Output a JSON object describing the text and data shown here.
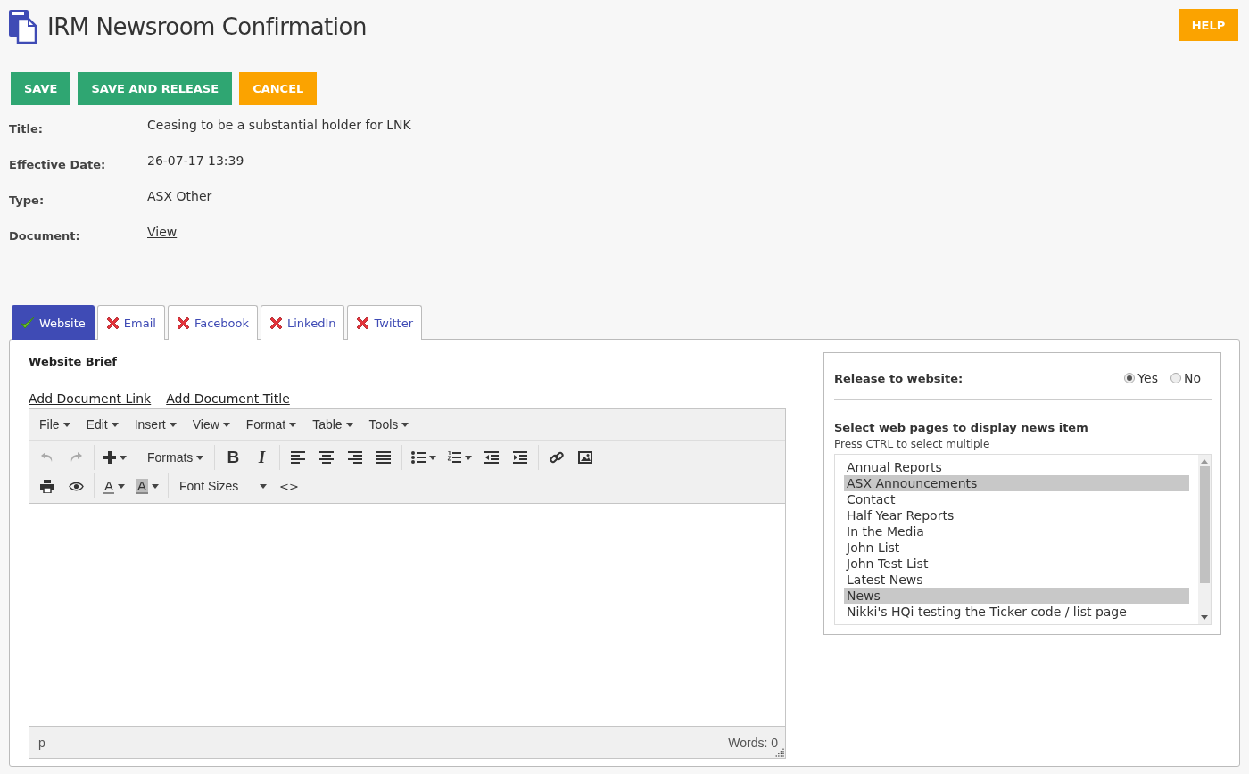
{
  "header": {
    "title": "IRM Newsroom Confirmation",
    "help": "HELP"
  },
  "actions": [
    {
      "label": "SAVE",
      "kind": "primary"
    },
    {
      "label": "SAVE AND RELEASE",
      "kind": "primary"
    },
    {
      "label": "CANCEL",
      "kind": "warning"
    }
  ],
  "details": [
    {
      "label": "Title:",
      "value": "Ceasing to be a substantial holder for LNK",
      "kind": "text"
    },
    {
      "label": "Effective Date:",
      "value": "26-07-17 13:39",
      "kind": "text"
    },
    {
      "label": "Type:",
      "value": "ASX Other",
      "kind": "text"
    },
    {
      "label": "Document:",
      "value": "View",
      "kind": "link"
    }
  ],
  "tabs": [
    {
      "label": "Website",
      "kind": "check",
      "selected": true
    },
    {
      "label": "Email",
      "kind": "cross",
      "selected": false
    },
    {
      "label": "Facebook",
      "kind": "cross",
      "selected": false
    },
    {
      "label": "LinkedIn",
      "kind": "cross",
      "selected": false
    },
    {
      "label": "Twitter",
      "kind": "cross",
      "selected": false
    }
  ],
  "brief": {
    "heading": "Website Brief",
    "links": [
      "Add Document Link",
      "Add Document Title"
    ]
  },
  "editor": {
    "menus": [
      "File",
      "Edit",
      "Insert",
      "View",
      "Format",
      "Table",
      "Tools"
    ],
    "toolbar_rows": [
      [
        {
          "kind": "undo",
          "disabled": true
        },
        {
          "kind": "redo",
          "disabled": true
        },
        {
          "kind": "sep"
        },
        {
          "kind": "plus",
          "disabled": false
        },
        {
          "kind": "sep"
        },
        {
          "kind": "select",
          "label": "Formats",
          "disabled": false
        },
        {
          "kind": "sep"
        },
        {
          "kind": "bold",
          "label": "B",
          "disabled": false
        },
        {
          "kind": "italic",
          "label": "I",
          "disabled": false
        },
        {
          "kind": "sep"
        },
        {
          "kind": "align-left",
          "disabled": false
        },
        {
          "kind": "align-center",
          "disabled": false
        },
        {
          "kind": "align-right",
          "disabled": false
        },
        {
          "kind": "align-justify",
          "disabled": false
        },
        {
          "kind": "sep"
        },
        {
          "kind": "bullets",
          "disabled": false
        },
        {
          "kind": "numbers",
          "disabled": false
        },
        {
          "kind": "outdent",
          "disabled": false
        },
        {
          "kind": "indent",
          "disabled": false
        },
        {
          "kind": "sep"
        },
        {
          "kind": "link",
          "disabled": false
        },
        {
          "kind": "image",
          "disabled": false
        }
      ],
      [
        {
          "kind": "print",
          "disabled": false
        },
        {
          "kind": "preview",
          "disabled": false
        },
        {
          "kind": "sep"
        },
        {
          "kind": "forecolor",
          "label": "A",
          "disabled": false
        },
        {
          "kind": "backcolor",
          "label": "A",
          "disabled": false
        },
        {
          "kind": "sep"
        },
        {
          "kind": "select-wide",
          "label": "Font Sizes",
          "disabled": false
        },
        {
          "kind": "code",
          "label": "<>",
          "disabled": false
        }
      ]
    ],
    "path": "p",
    "words": "Words: 0"
  },
  "release": {
    "label": "Release to website:",
    "options": [
      {
        "label": "Yes",
        "selected": true
      },
      {
        "label": "No",
        "selected": false
      }
    ],
    "pages_heading": "Select web pages to display news item",
    "hint": "Press CTRL to select multiple",
    "pages": [
      {
        "label": "Annual Reports",
        "selected": false
      },
      {
        "label": "ASX Announcements",
        "selected": true
      },
      {
        "label": "Contact",
        "selected": false
      },
      {
        "label": "Half Year Reports",
        "selected": false
      },
      {
        "label": "In the Media",
        "selected": false
      },
      {
        "label": "John List",
        "selected": false
      },
      {
        "label": "John Test List",
        "selected": false
      },
      {
        "label": "Latest News",
        "selected": false
      },
      {
        "label": "News",
        "selected": true
      },
      {
        "label": "Nikki's HQi testing the Ticker code / list page",
        "selected": false
      }
    ]
  }
}
